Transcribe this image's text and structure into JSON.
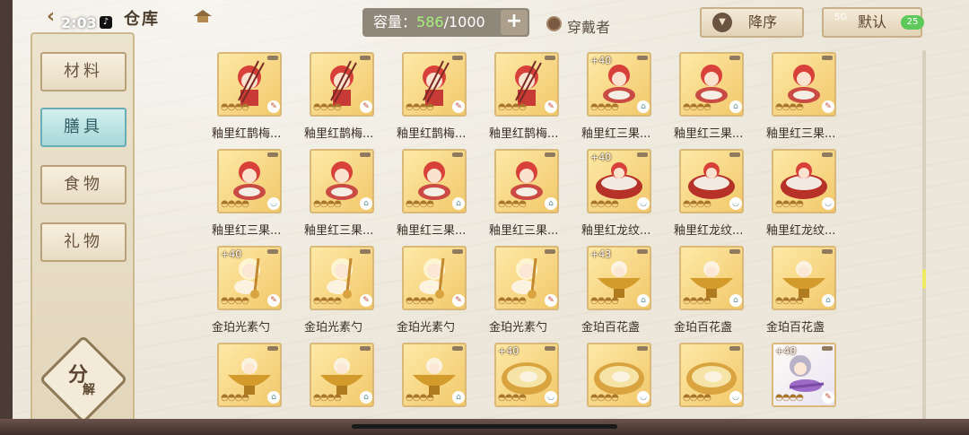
{
  "status_bar": {
    "time": "2:03",
    "battery": "25",
    "signal": "5G"
  },
  "header": {
    "title": "仓库",
    "capacity_label": "容量：",
    "capacity_current": "586",
    "capacity_total": "/1000",
    "add_label": "+",
    "worn_label": "穿戴者",
    "sort_label": "降序",
    "filter_label": "默认"
  },
  "sidebar": {
    "tabs": [
      {
        "label": "材料",
        "active": false
      },
      {
        "label": "膳具",
        "active": true
      },
      {
        "label": "食物",
        "active": false
      },
      {
        "label": "礼物",
        "active": false
      }
    ],
    "decompose_a": "分",
    "decompose_b": "解"
  },
  "colors": {
    "accent_tab": "#a7d8d8",
    "capacity_value": "#a7f07a",
    "card_gold": "#f2c86a"
  },
  "items": [
    {
      "name": "釉里红鹊梅...",
      "plus": "",
      "kind": "chopsticks",
      "icon": "pen-icon"
    },
    {
      "name": "釉里红鹊梅...",
      "plus": "",
      "kind": "chopsticks",
      "icon": "pen-icon"
    },
    {
      "name": "釉里红鹊梅...",
      "plus": "",
      "kind": "chopsticks",
      "icon": "pen-icon"
    },
    {
      "name": "釉里红鹊梅...",
      "plus": "",
      "kind": "chopsticks",
      "icon": "pen-icon"
    },
    {
      "name": "釉里红三果...",
      "plus": "+40",
      "kind": "girl-red",
      "icon": "hat-icon"
    },
    {
      "name": "釉里红三果...",
      "plus": "",
      "kind": "girl-red",
      "icon": "hat-icon"
    },
    {
      "name": "釉里红三果...",
      "plus": "",
      "kind": "girl-red",
      "icon": "pen-icon"
    },
    {
      "name": "釉里红三果...",
      "plus": "",
      "kind": "girl-red",
      "icon": "bowl-icon"
    },
    {
      "name": "釉里红三果...",
      "plus": "",
      "kind": "girl-red",
      "icon": "hat-icon"
    },
    {
      "name": "釉里红三果...",
      "plus": "",
      "kind": "girl-red",
      "icon": "hat-icon"
    },
    {
      "name": "釉里红三果...",
      "plus": "",
      "kind": "girl-red",
      "icon": "hat-icon"
    },
    {
      "name": "釉里红龙纹...",
      "plus": "+40",
      "kind": "red-bowl",
      "icon": "bowl-icon"
    },
    {
      "name": "釉里红龙纹...",
      "plus": "",
      "kind": "red-bowl",
      "icon": "bowl-icon"
    },
    {
      "name": "釉里红龙纹...",
      "plus": "",
      "kind": "red-bowl",
      "icon": "bowl-icon"
    },
    {
      "name": "金珀光素勺",
      "plus": "+40",
      "kind": "ladle",
      "icon": "pen-icon"
    },
    {
      "name": "金珀光素勺",
      "plus": "",
      "kind": "ladle",
      "icon": "pen-icon"
    },
    {
      "name": "金珀光素勺",
      "plus": "",
      "kind": "ladle",
      "icon": "pen-icon"
    },
    {
      "name": "金珀光素勺",
      "plus": "",
      "kind": "ladle",
      "icon": "pen-icon"
    },
    {
      "name": "金珀百花盏",
      "plus": "+43",
      "kind": "gold-cup",
      "icon": "hat-icon"
    },
    {
      "name": "金珀百花盏",
      "plus": "",
      "kind": "gold-cup",
      "icon": "hat-icon"
    },
    {
      "name": "金珀百花盏",
      "plus": "",
      "kind": "gold-cup",
      "icon": "hat-icon"
    },
    {
      "name": "",
      "plus": "",
      "kind": "gold-cup",
      "icon": "hat-icon"
    },
    {
      "name": "",
      "plus": "",
      "kind": "gold-cup",
      "icon": "hat-icon"
    },
    {
      "name": "",
      "plus": "",
      "kind": "gold-cup",
      "icon": "hat-icon"
    },
    {
      "name": "",
      "plus": "+40",
      "kind": "gold-plate",
      "icon": "bowl-icon"
    },
    {
      "name": "",
      "plus": "",
      "kind": "gold-plate",
      "icon": "bowl-icon"
    },
    {
      "name": "",
      "plus": "",
      "kind": "gold-plate",
      "icon": "bowl-icon"
    },
    {
      "name": "",
      "plus": "+40",
      "kind": "purple-spoon",
      "icon": "pen-icon"
    }
  ]
}
